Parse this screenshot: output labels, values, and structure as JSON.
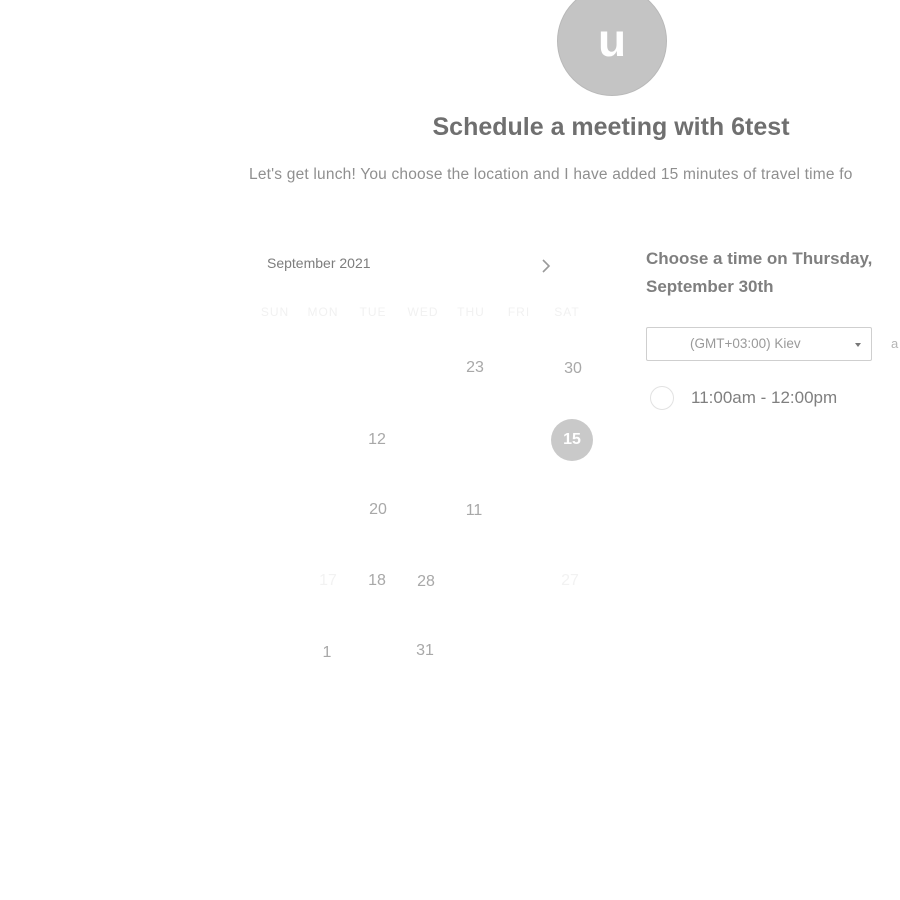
{
  "avatar": {
    "initial": "u"
  },
  "header": {
    "title": "Schedule a meeting with 6test",
    "subtitle": "Let's get lunch! You choose the location and I have added 15 minutes of travel time fo"
  },
  "calendar": {
    "month_label": "September 2021",
    "weekdays": [
      "SUN",
      "MON",
      "TUE",
      "WED",
      "THU",
      "FRI",
      "SAT"
    ],
    "days": {
      "d23": "23",
      "d30": "30",
      "d12": "12",
      "d15": "15",
      "d20": "20",
      "d11": "11",
      "d18": "18",
      "d28": "28",
      "d1": "1",
      "d31": "31",
      "faint_a": "17",
      "faint_b": "27"
    },
    "selected_day": "15"
  },
  "times": {
    "heading": "Choose a time on Thursday, September 30th",
    "timezone": "(GMT+03:00) Kiev",
    "timezone_extra": "a",
    "slots": [
      {
        "label": "11:00am - 12:00pm"
      }
    ]
  }
}
